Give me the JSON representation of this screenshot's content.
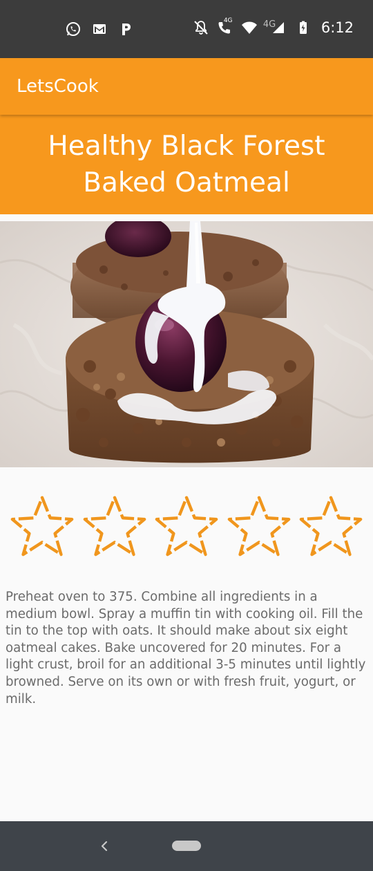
{
  "status_bar": {
    "time": "6:12",
    "left_icons": [
      "whatsapp-icon",
      "gmail-icon",
      "paypal-icon"
    ],
    "right_icons": [
      "notifications-off-icon",
      "volte-call-icon",
      "wifi-icon",
      "signal-4g-icon",
      "battery-charging-icon"
    ],
    "network_label_1": "4G",
    "network_label_2": "4G"
  },
  "app_bar": {
    "title": "LetsCook"
  },
  "recipe": {
    "title": "Healthy Black Forest Baked Oatmeal",
    "image_alt": "cherry-oatmeal-cup-photo",
    "rating": {
      "max": 5,
      "value": 0
    },
    "instructions": "Preheat oven to 375. Combine all ingredients in a medium bowl. Spray a muffin tin with cooking oil. Fill the tin to the top with oats. It should make about six  eight oatmeal cakes. Bake uncovered for 20 minutes. For a light crust, broil for an additional 3-5 minutes until lightly browned. Serve on its own or with fresh fruit, yogurt, or milk."
  },
  "nav_bar": {
    "back_icon": "back-chevron-icon",
    "home_icon": "home-pill-icon"
  },
  "colors": {
    "accent": "#f7981d",
    "status_bar": "#3c3c3c",
    "nav_bar": "#3f444a",
    "background": "#fafafa",
    "text": "#6b6b6b",
    "star_outline": "#f0961d"
  }
}
